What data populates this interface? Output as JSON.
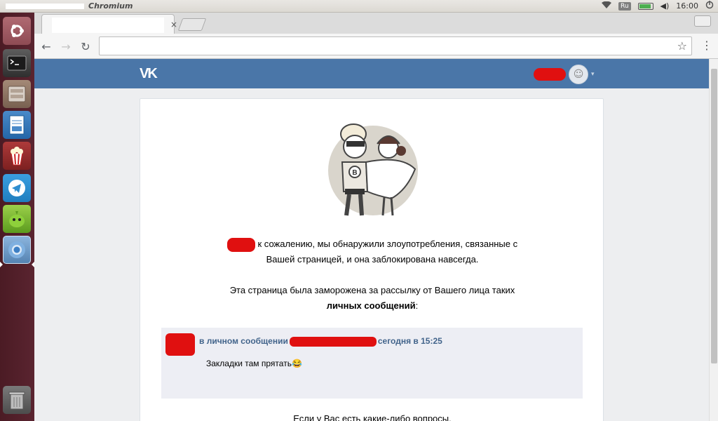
{
  "system": {
    "app_title": "Chromium",
    "keyboard_layout": "Ru",
    "volume": "◀)",
    "clock": "16:00"
  },
  "launcher": {
    "items": [
      "ubuntu-dash",
      "terminal",
      "files",
      "libreoffice-writer",
      "popcorn-time",
      "telegram",
      "pidgin",
      "chromium",
      "trash"
    ]
  },
  "browser": {
    "tab_close": "×",
    "user_button": "",
    "back": "←",
    "forward": "→",
    "reload": "↻",
    "bookmark": "☆",
    "menu": "⋮"
  },
  "vk": {
    "logo": "VK",
    "user_caret": "▾",
    "avatar_glyph": "☺",
    "message_line1_tail": "к сожалению, мы обнаружили злоупотребления, связанные с",
    "message_line1b": "Вашей страницей, и она заблокирована навсегда.",
    "message_line2": "Эта страница была заморожена за рассылку от Вашего лица таких",
    "message_line2_bold": "личных сообщений",
    "message_line2_colon": ":",
    "quote_prefix": "в личном сообщении",
    "quote_time": "сегодня в 15:25",
    "quote_text": "Закладки там прятать😂",
    "footer": "Если у Вас есть какие-либо вопросы,"
  }
}
